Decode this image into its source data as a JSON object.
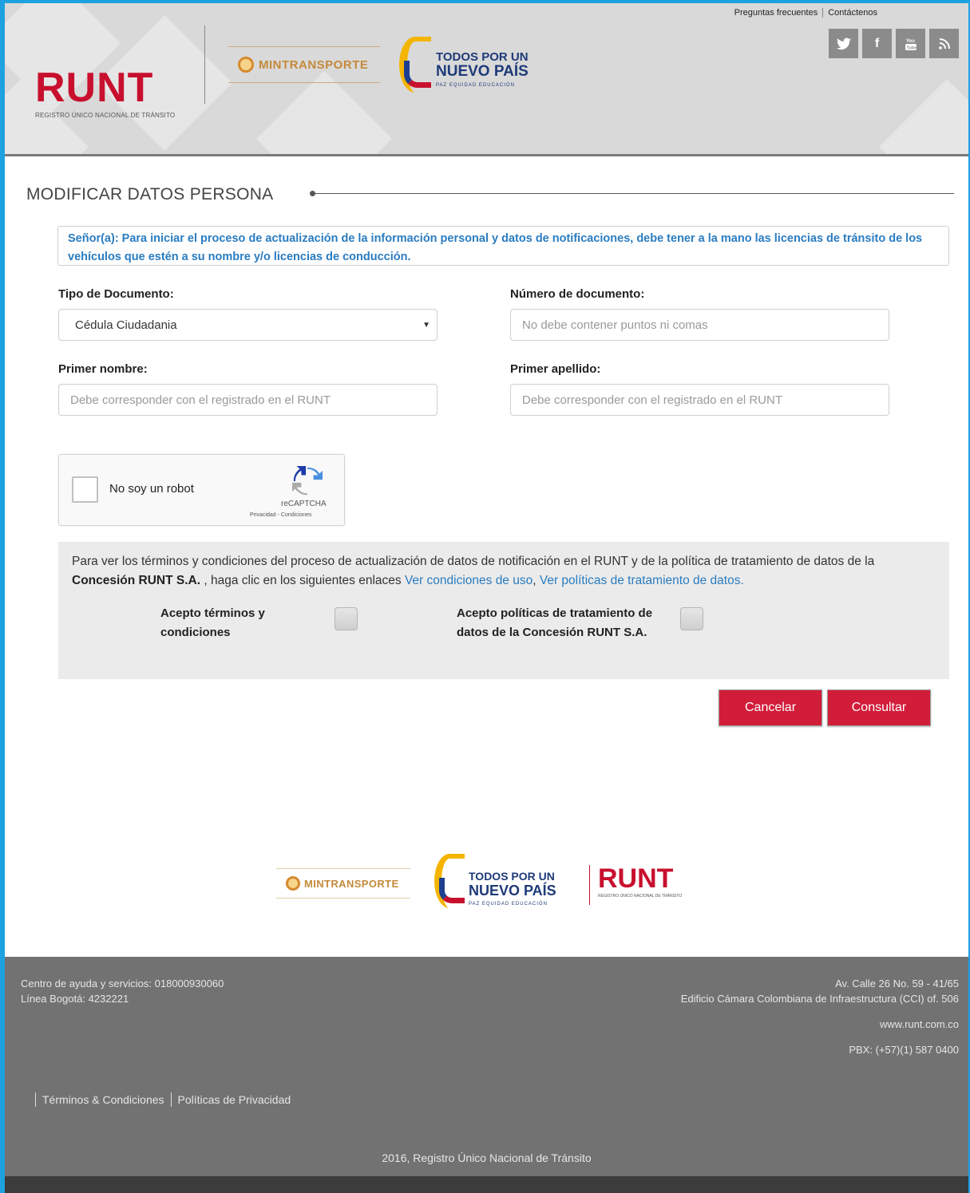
{
  "header": {
    "runt_logo": "RUNT",
    "runt_subtitle": "REGISTRO ÚNICO NACIONAL DE TRÁNSITO",
    "mintransporte": "MINTRANSPORTE",
    "gov_logo_line1": "TODOS POR UN",
    "gov_logo_line2": "NUEVO PAÍS",
    "gov_logo_line3": "PAZ  EQUIDAD  EDUCACIÓN",
    "top_links": [
      "Preguntas frecuentes",
      "Contáctenos"
    ],
    "social": [
      {
        "name": "twitter-icon",
        "glyph": "t"
      },
      {
        "name": "facebook-icon",
        "glyph": "f"
      },
      {
        "name": "youtube-icon",
        "glyph": "▶"
      },
      {
        "name": "rss-icon",
        "glyph": "☰"
      }
    ]
  },
  "main": {
    "title": "MODIFICAR DATOS PERSONA",
    "notice": "Señor(a): Para iniciar el proceso de actualización de la información personal y datos de notificaciones, debe tener a la mano las licencias de tránsito de los vehículos que estén a su nombre y/o licencias de conducción.",
    "doc_type_label": "Tipo de Documento:",
    "doc_type_value": "Cédula Ciudadania",
    "doc_number_label": "Número de documento:",
    "doc_number_placeholder": "No debe contener puntos ni comas",
    "first_name_label": "Primer nombre:",
    "first_name_placeholder": "Debe corresponder con el registrado en el RUNT",
    "last_name_label": "Primer apellido:",
    "last_name_placeholder": "Debe corresponder con el registrado en el RUNT",
    "captcha": {
      "label": "No soy un robot",
      "brand": "reCAPTCHA",
      "links": "Privacidad - Condiciones"
    },
    "terms": {
      "text_before": "Para ver los términos y condiciones del proceso de actualización de datos de notificación en el RUNT y de la política de tratamiento de datos de la ",
      "company": "Concesión RUNT S.A.",
      "text_middle": " , haga clic en los siguientes enlaces ",
      "link1": "Ver condiciones de uso",
      "comma": ", ",
      "link2": "Ver políticas de tratamiento de datos.",
      "accept_terms": "Acepto términos y condiciones",
      "accept_policies": "Acepto políticas de tratamiento de datos de la Concesión RUNT S.A."
    },
    "cancel_label": "Cancelar",
    "submit_label": "Consultar"
  },
  "footer_logos": {
    "mintransporte": "MINTRANSPORTE",
    "gov_line1": "TODOS POR UN",
    "gov_line2": "NUEVO PAÍS",
    "gov_line3": "PAZ  EQUIDAD  EDUCACIÓN",
    "runt": "RUNT",
    "runt_subtitle": "REGISTRO ÚNICO NACIONAL DE TRÁNSITO"
  },
  "footer": {
    "help_center": "Centro de ayuda y servicios: 018000930060",
    "bogota_line": "Línea Bogotá: 4232221",
    "address1": "Av. Calle 26 No. 59 - 41/65",
    "address2": "Edificio Cámara Colombiana de Infraestructura (CCI) of. 506",
    "website": "www.runt.com.co",
    "pbx": "PBX: (+57)(1) 587 0400",
    "terms_link": "Términos & Condiciones",
    "privacy_link": "Políticas de Privacidad",
    "copyright": "2016, Registro Único Nacional de Tránsito"
  },
  "colors": {
    "brand_red": "#d11d3a",
    "link_blue": "#2a7cc0",
    "frame_blue": "#1da1e0",
    "footer_gray": "#727272"
  }
}
